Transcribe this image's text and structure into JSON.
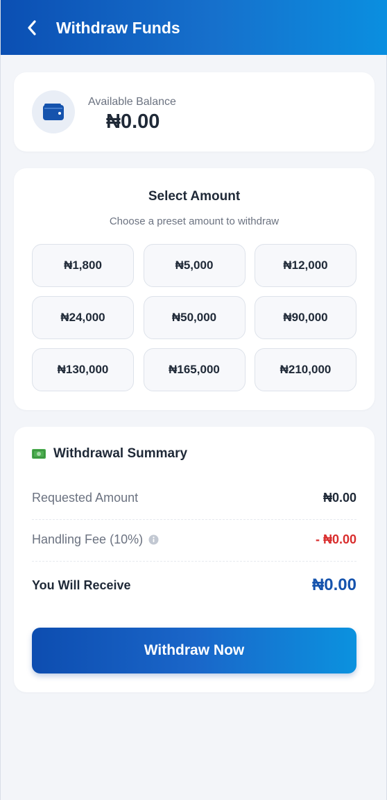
{
  "header": {
    "title": "Withdraw Funds",
    "back_icon": "chevron-left-icon"
  },
  "balance": {
    "icon": "wallet-icon",
    "label": "Available Balance",
    "value": "₦0.00"
  },
  "amounts": {
    "title": "Select Amount",
    "subtitle": "Choose a preset amount to withdraw",
    "presets": [
      "₦1,800",
      "₦5,000",
      "₦12,000",
      "₦24,000",
      "₦50,000",
      "₦90,000",
      "₦130,000",
      "₦165,000",
      "₦210,000"
    ]
  },
  "summary": {
    "icon": "money-bill-icon",
    "title": "Withdrawal Summary",
    "requested_label": "Requested Amount",
    "requested_value": "₦0.00",
    "fee_label": "Handling Fee (10%)",
    "fee_value": "- ₦0.00",
    "receive_label": "You Will Receive",
    "receive_value": "₦0.00",
    "button_label": "Withdraw Now"
  },
  "colors": {
    "primary": "#1553ad",
    "accent": "#0a8fe0",
    "danger": "#d92d2d",
    "background": "#f3f5f9"
  }
}
